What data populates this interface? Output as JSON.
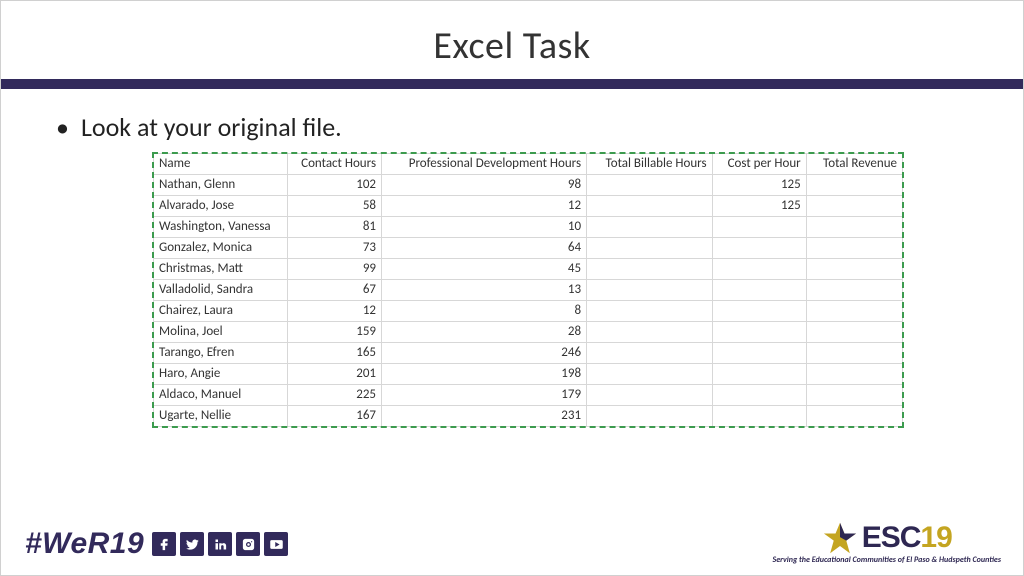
{
  "title": "Excel Task",
  "bullet": "Look at your original file.",
  "sheet": {
    "headers": [
      "Name",
      "Contact Hours",
      "Professional Development Hours",
      "Total Billable Hours",
      "Cost per Hour",
      "Total Revenue"
    ],
    "rows": [
      {
        "name": "Nathan, Glenn",
        "contact": "102",
        "pdh": "98",
        "tbh": "",
        "cph": "125",
        "tr": ""
      },
      {
        "name": "Alvarado, Jose",
        "contact": "58",
        "pdh": "12",
        "tbh": "",
        "cph": "125",
        "tr": ""
      },
      {
        "name": "Washington, Vanessa",
        "contact": "81",
        "pdh": "10",
        "tbh": "",
        "cph": "",
        "tr": ""
      },
      {
        "name": "Gonzalez, Monica",
        "contact": "73",
        "pdh": "64",
        "tbh": "",
        "cph": "",
        "tr": ""
      },
      {
        "name": "Christmas, Matt",
        "contact": "99",
        "pdh": "45",
        "tbh": "",
        "cph": "",
        "tr": ""
      },
      {
        "name": "Valladolid, Sandra",
        "contact": "67",
        "pdh": "13",
        "tbh": "",
        "cph": "",
        "tr": ""
      },
      {
        "name": "Chairez, Laura",
        "contact": "12",
        "pdh": "8",
        "tbh": "",
        "cph": "",
        "tr": ""
      },
      {
        "name": "Molina, Joel",
        "contact": "159",
        "pdh": "28",
        "tbh": "",
        "cph": "",
        "tr": ""
      },
      {
        "name": "Tarango, Efren",
        "contact": "165",
        "pdh": "246",
        "tbh": "",
        "cph": "",
        "tr": ""
      },
      {
        "name": "Haro, Angie",
        "contact": "201",
        "pdh": "198",
        "tbh": "",
        "cph": "",
        "tr": ""
      },
      {
        "name": "Aldaco, Manuel",
        "contact": "225",
        "pdh": "179",
        "tbh": "",
        "cph": "",
        "tr": ""
      },
      {
        "name": "Ugarte, Nellie",
        "contact": "167",
        "pdh": "231",
        "tbh": "",
        "cph": "",
        "tr": ""
      }
    ]
  },
  "footer": {
    "hashtag": "#WeR19",
    "esc_brand": "ESC",
    "esc_num": "19",
    "esc_tag": "Serving the Educational Communities of El Paso & Hudspeth Counties"
  }
}
